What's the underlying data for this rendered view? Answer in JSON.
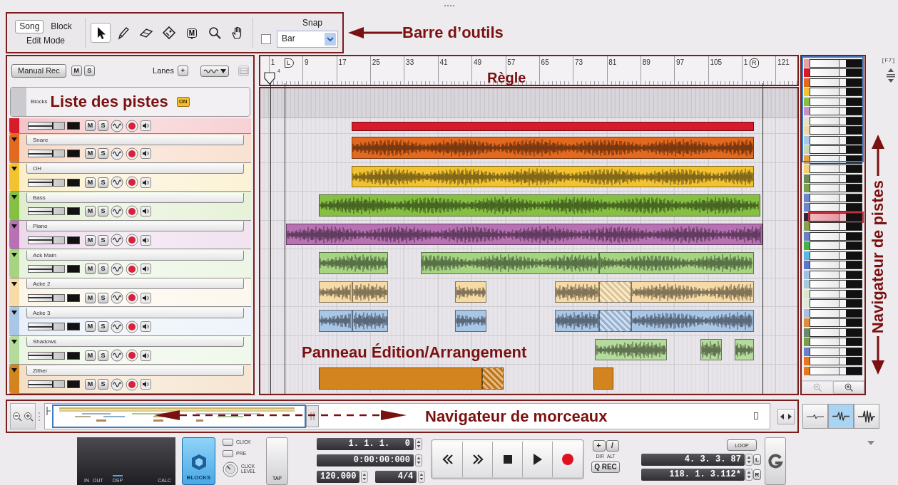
{
  "toolbar": {
    "edit_mode": {
      "label": "Edit Mode",
      "options": [
        {
          "label": "Song",
          "selected": true
        },
        {
          "label": "Block",
          "selected": false
        }
      ]
    },
    "tools": [
      {
        "kind": "pointer",
        "selected": true
      },
      {
        "kind": "pencil",
        "selected": false
      },
      {
        "kind": "eraser",
        "selected": false
      },
      {
        "kind": "paint",
        "selected": false
      },
      {
        "kind": "marker",
        "label": "M",
        "selected": false
      },
      {
        "kind": "zoom",
        "selected": false
      },
      {
        "kind": "hand",
        "selected": false
      }
    ],
    "snap": {
      "label": "Snap",
      "checked": false,
      "value": "Bar"
    },
    "callout": "Barre d’outils"
  },
  "ruler": {
    "labels": [
      "1",
      "9",
      "17",
      "25",
      "33",
      "41",
      "49",
      "57",
      "65",
      "73",
      "81",
      "89",
      "97",
      "105",
      "1",
      "121"
    ],
    "signature": "4",
    "loop_start_marker": "L",
    "loop_end_marker": "R",
    "callout": "Règle"
  },
  "track_list": {
    "manual_rec": "Manual Rec",
    "mute": "M",
    "solo": "S",
    "lanes_label": "Lanes",
    "add_lane": "+",
    "lane_tool_disabled": true,
    "blocks_label": "Blocks",
    "blocks_badge": "ON",
    "callout": "Liste des pistes",
    "tracks": [
      {
        "color": "#d81b2b",
        "level": 0.7,
        "mute": "M",
        "solo": "S"
      },
      {
        "name": "Snare",
        "color": "#e2691e",
        "level": 0.7,
        "mute": "M",
        "solo": "S"
      },
      {
        "name": "OH",
        "color": "#f2c230",
        "level": 0.7,
        "mute": "M",
        "solo": "S"
      },
      {
        "name": "Bass",
        "color": "#86c043",
        "level": 0.7,
        "mute": "M",
        "solo": "S"
      },
      {
        "name": "Piano",
        "color": "#b872b4",
        "level": 0.7,
        "mute": "M",
        "solo": "S"
      },
      {
        "name": "Ack Main",
        "color": "#a6d483",
        "level": 0.7,
        "mute": "M",
        "solo": "S"
      },
      {
        "name": "Acke 2",
        "color": "#f6dba6",
        "level": 0.7,
        "mute": "M",
        "solo": "S"
      },
      {
        "name": "Acke 3",
        "color": "#a9c6e6",
        "level": 0.7,
        "mute": "M",
        "solo": "S"
      },
      {
        "name": "Shadows",
        "color": "#b5db9c",
        "level": 0.7,
        "mute": "M",
        "solo": "S"
      },
      {
        "name": "Zither",
        "color": "#d4841f",
        "level": 0.7,
        "mute": "M",
        "solo": "S"
      }
    ]
  },
  "editor": {
    "callout": "Panneau Édition/Arrangement"
  },
  "track_navigator": {
    "shortcut": "[F7]",
    "callout": "Navigateur de pistes",
    "zoom_out_disabled": true,
    "rows": [
      {
        "color": "#e8a0a8",
        "selected": false
      },
      {
        "color": "#d81b2b",
        "selected": false
      },
      {
        "color": "#e2691e",
        "selected": false
      },
      {
        "color": "#f2c230",
        "selected": false
      },
      {
        "color": "#86c043",
        "selected": false
      },
      {
        "color": "#c890c8",
        "selected": false
      },
      {
        "color": "#e8e0c8",
        "selected": false
      },
      {
        "color": "#f0d8a8",
        "selected": false
      },
      {
        "color": "#a8c8e8",
        "selected": false
      },
      {
        "color": "#c8d8b0",
        "selected": false
      },
      {
        "color": "#e8a040",
        "selected": false
      },
      {
        "color": "#f0d070",
        "selected": false
      },
      {
        "color": "#6a8a5a",
        "selected": false
      },
      {
        "color": "#7aa048",
        "selected": false
      },
      {
        "color": "#6a88c8",
        "selected": false
      },
      {
        "color": "#6a88c8",
        "selected": false
      },
      {
        "color": "#302838",
        "selected": true
      },
      {
        "color": "#86a050",
        "selected": false
      },
      {
        "color": "#6a80c0",
        "selected": false
      },
      {
        "color": "#48b048",
        "selected": false
      },
      {
        "color": "#58b8e0",
        "selected": false
      },
      {
        "color": "#5a78c8",
        "selected": false
      },
      {
        "color": "#a0c0e0",
        "selected": false
      },
      {
        "color": "#a8c8d8",
        "selected": false
      },
      {
        "color": "#d8e8c8",
        "selected": false
      },
      {
        "color": "#e0e8d8",
        "selected": false
      },
      {
        "color": "#a8c0e0",
        "selected": false
      },
      {
        "color": "#d89040",
        "selected": false
      },
      {
        "color": "#6a8a70",
        "selected": false
      },
      {
        "color": "#78a048",
        "selected": false
      },
      {
        "color": "#6a80c8",
        "selected": false
      },
      {
        "color": "#e87820",
        "selected": false
      },
      {
        "color": "#e87820",
        "selected": false
      }
    ]
  },
  "song_navigator": {
    "callout": "Navigateur de morceaux"
  },
  "waveform_zoom": [
    {
      "selected": false
    },
    {
      "selected": true
    },
    {
      "selected": false
    }
  ],
  "transport": {
    "meter_labels": [
      "IN",
      "OUT",
      "DSP",
      "CALC"
    ],
    "blocks": "BLOCKS",
    "click": {
      "label": "CLICK",
      "checked": false
    },
    "pre": {
      "label": "PRE",
      "checked": false
    },
    "click_level": "CLICK LEVEL",
    "tap": "TAP",
    "position": "1. 1. 1.   0",
    "time": "0:00:00:000",
    "tempo": "120.000",
    "signature": "4/4",
    "add": "+",
    "slash": "/",
    "dir": "DIR",
    "alt": "ALT",
    "q_rec": "Q REC",
    "loop": "LOOP",
    "loop_start": "4. 3. 3. 87",
    "loop_start_button": "L",
    "loop_end": "118. 1. 3.112*",
    "loop_end_button": "R"
  }
}
